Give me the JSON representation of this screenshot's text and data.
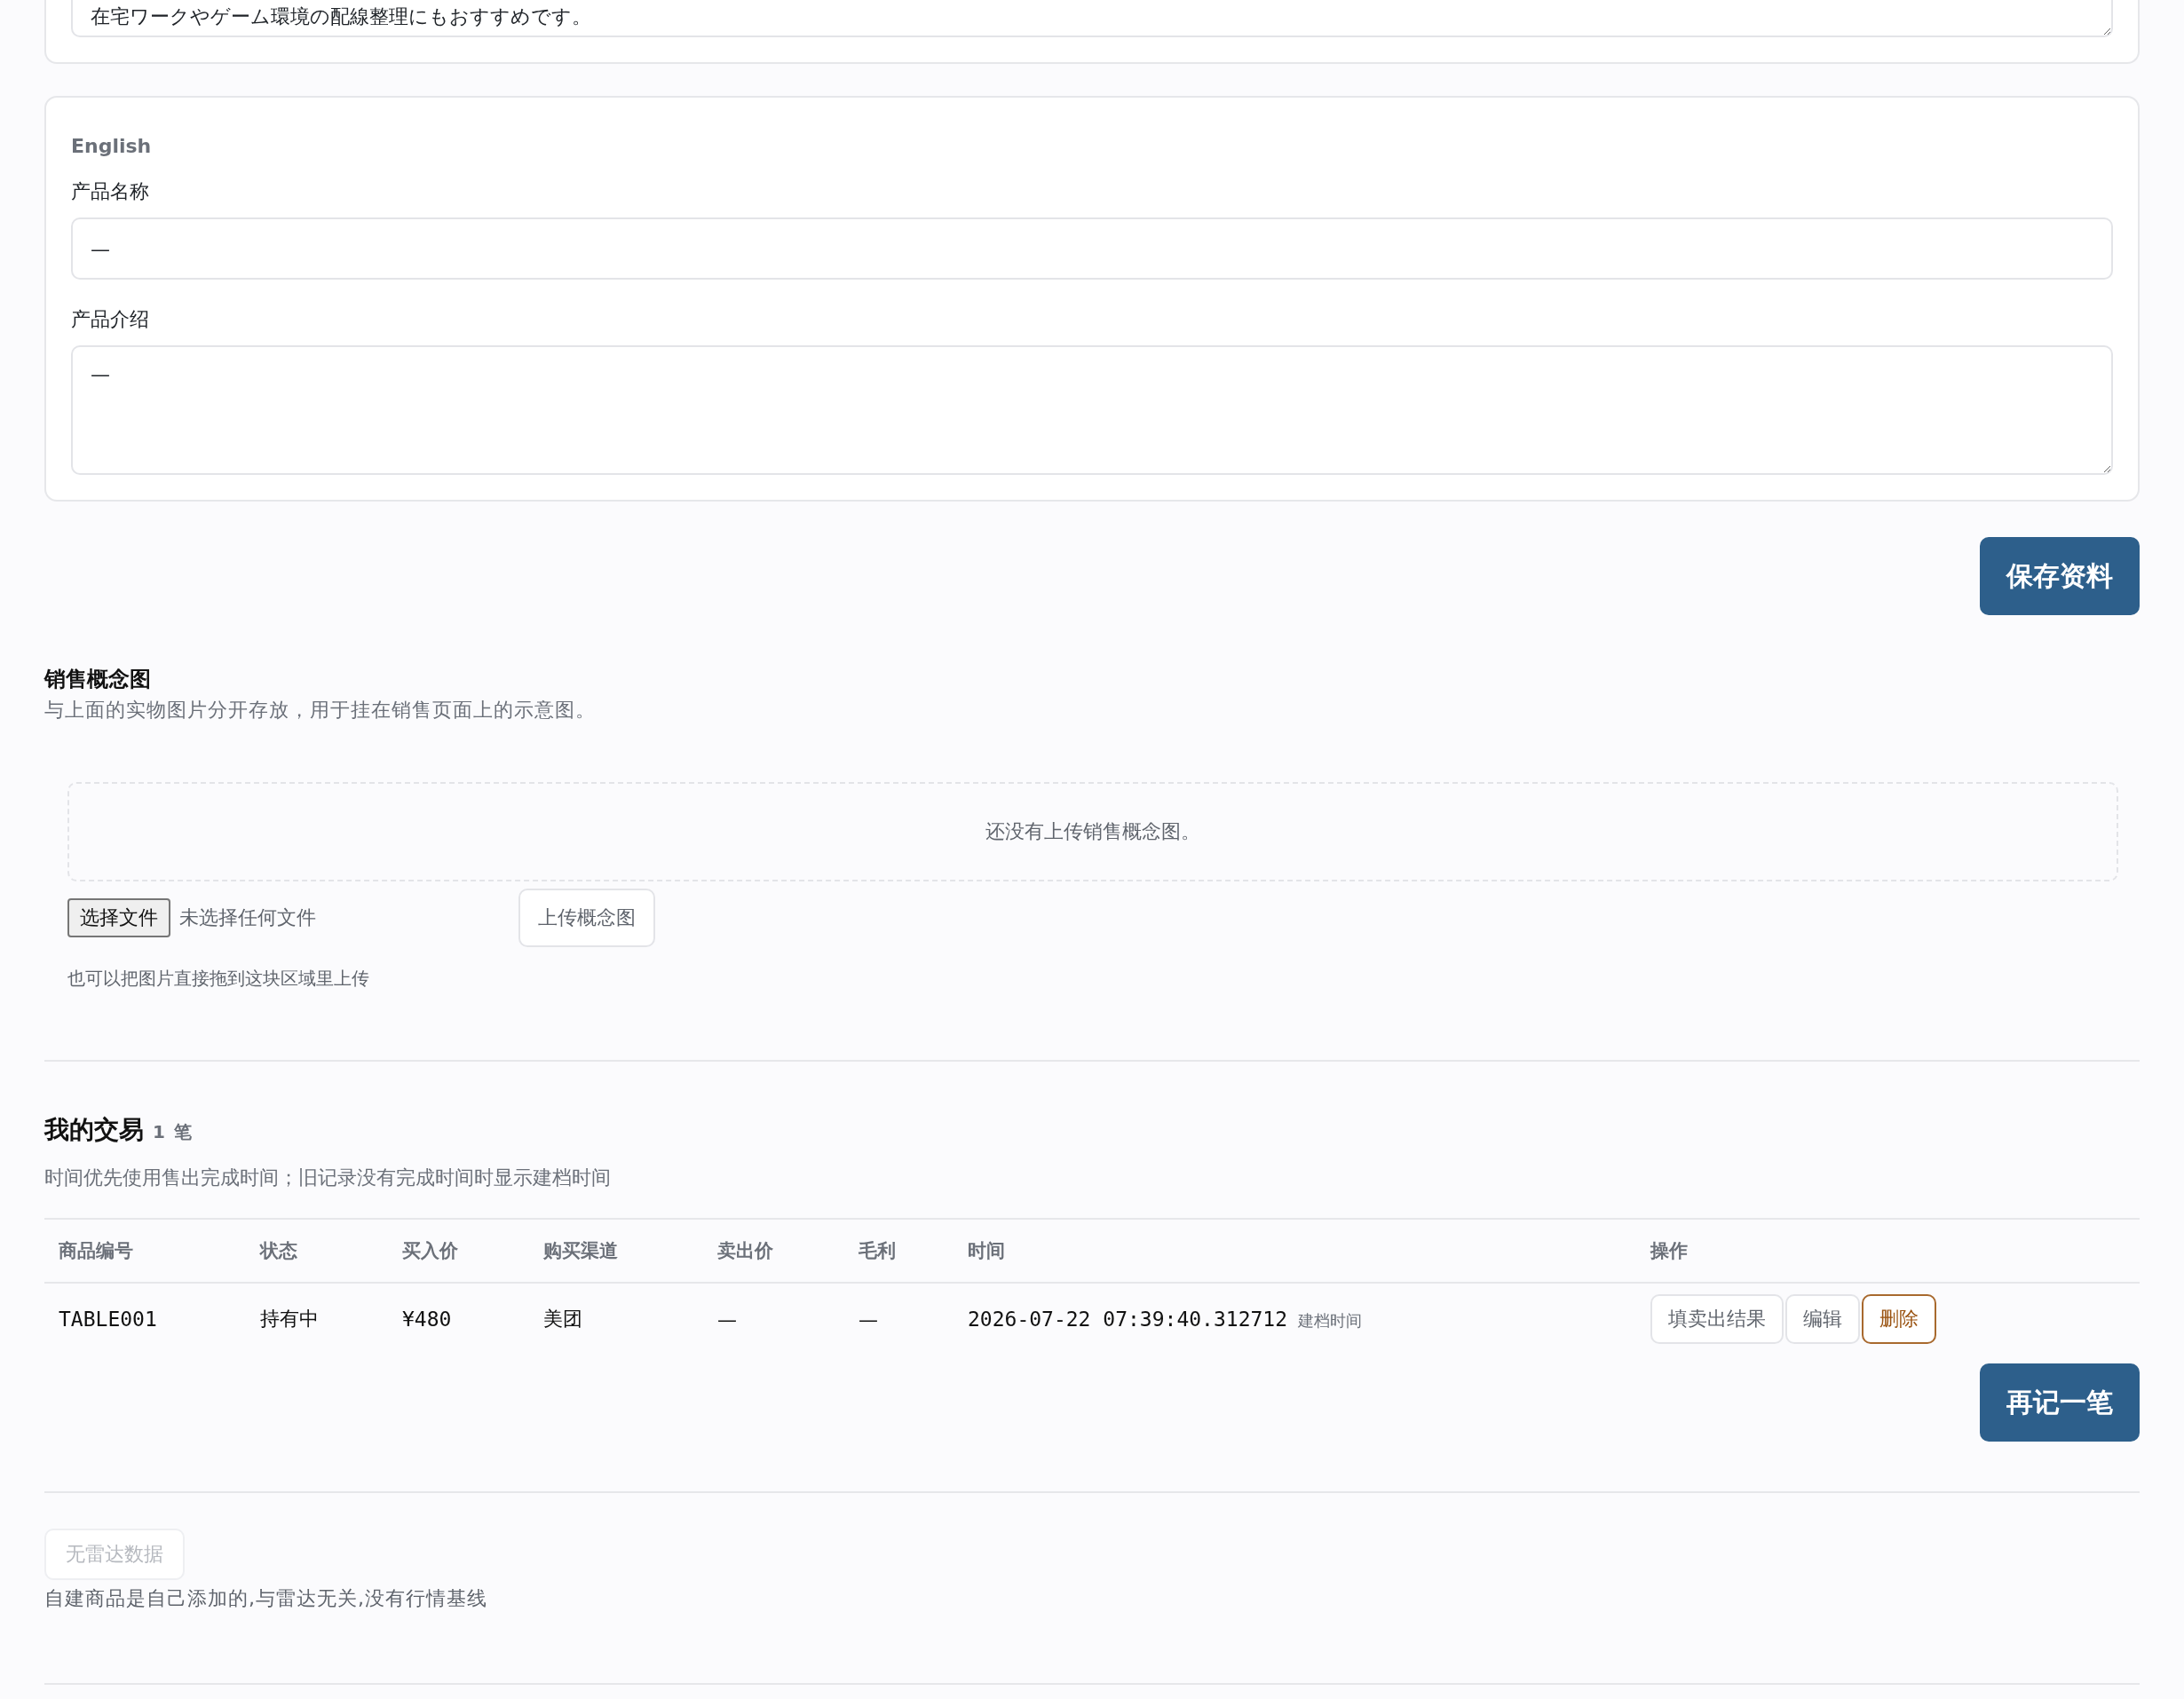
{
  "description_card": {
    "textarea_value": "在宅ワークやゲーム環境の配線整理にもおすすめです。"
  },
  "english_card": {
    "title": "English",
    "fields": [
      {
        "label": "产品名称",
        "kind": "input",
        "value": "—"
      },
      {
        "label": "产品介绍",
        "kind": "textarea",
        "value": "—"
      }
    ]
  },
  "save_button": "保存资料",
  "concept_image": {
    "title": "销售概念图",
    "subtitle": "与上面的实物图片分开存放，用于挂在销售页面上的示意图。",
    "empty_text": "还没有上传销售概念图。",
    "file_button": "选择文件",
    "file_status": "未选择任何文件",
    "upload_button": "上传概念图",
    "hint": "也可以把图片直接拖到这块区域里上传"
  },
  "trades": {
    "title": "我的交易",
    "count": "1",
    "unit": "笔",
    "subtitle": "时间优先使用售出完成时间；旧记录没有完成时间时显示建档时间",
    "columns": [
      "商品编号",
      "状态",
      "买入价",
      "购买渠道",
      "卖出价",
      "毛利",
      "时间",
      "操作"
    ],
    "rows": [
      {
        "cells": [
          "TABLE001",
          "持有中",
          "¥480",
          "美团",
          "—",
          "—"
        ],
        "time": "2026-07-22 07:39:40.312712",
        "time_note": "建档时间",
        "actions": [
          {
            "label": "填卖出结果",
            "kind": "default"
          },
          {
            "label": "编辑",
            "kind": "default"
          },
          {
            "label": "删除",
            "kind": "danger"
          }
        ]
      }
    ],
    "add_button": "再记一笔"
  },
  "radar": {
    "button": {
      "label": "无雷达数据",
      "disabled": true
    },
    "note": "自建商品是自己添加的,与雷达无关,没有行情基线"
  }
}
